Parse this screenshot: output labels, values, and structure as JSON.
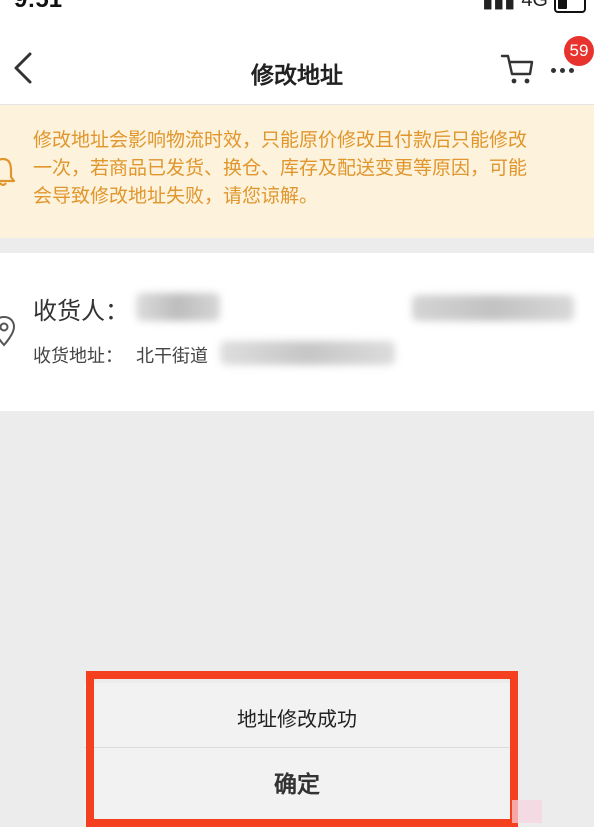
{
  "status_bar": {
    "time": "9:51",
    "network": "4G"
  },
  "header": {
    "title": "修改地址",
    "cart_badge": "59"
  },
  "notice": {
    "lines": [
      "修改地址会影响物流时效，只能原价修改且付款后只能修改",
      "一次，若商品已发货、换仓、库存及配送变更等原因，可能",
      "会导致修改地址失败，请您谅解。"
    ]
  },
  "address": {
    "recipient_label": "收货人：",
    "address_label": "收货地址：",
    "street": "北干街道"
  },
  "dialog": {
    "message": "地址修改成功",
    "confirm_label": "确定"
  },
  "colors": {
    "accent": "#e0962c",
    "notice_bg": "#fdf2dc",
    "badge": "#e8322d",
    "highlight": "#f4401f"
  }
}
